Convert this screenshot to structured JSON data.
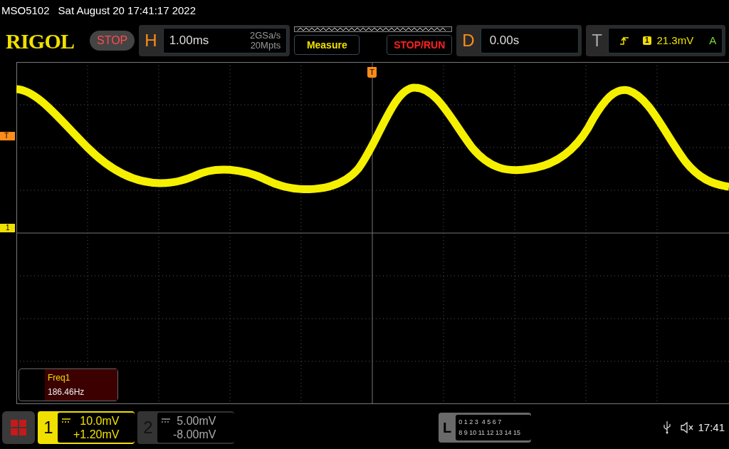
{
  "status_line": {
    "model": "MSO5102",
    "datetime": "Sat August 20 17:41:17 2022"
  },
  "brand": "RIGOL",
  "run_state": "STOP",
  "horizontal": {
    "label": "H",
    "timebase": "1.00ms",
    "sample_rate": "2GSa/s",
    "memory_depth": "20Mpts"
  },
  "buttons": [
    "Measure",
    "STOP/RUN"
  ],
  "delay": {
    "label": "D",
    "value": "0.00s"
  },
  "trigger": {
    "label": "T",
    "source": "1",
    "level": "21.3mV",
    "mode": "A"
  },
  "markers": {
    "trigger_position": "T",
    "trigger_level": "T",
    "channel_1": "1"
  },
  "measurement": {
    "name": "Freq1",
    "value": "186.46Hz"
  },
  "channels": [
    {
      "number": "1",
      "scale": "10.0mV",
      "offset": "+1.20mV",
      "on": true
    },
    {
      "number": "2",
      "scale": "5.00mV",
      "offset": "-8.00mV",
      "on": false
    }
  ],
  "logic": {
    "label": "L",
    "rows": [
      "0 1 2 3  4 5 6 7",
      "8 9 10 11 12 13 14 15"
    ]
  },
  "clock": "17:41"
}
